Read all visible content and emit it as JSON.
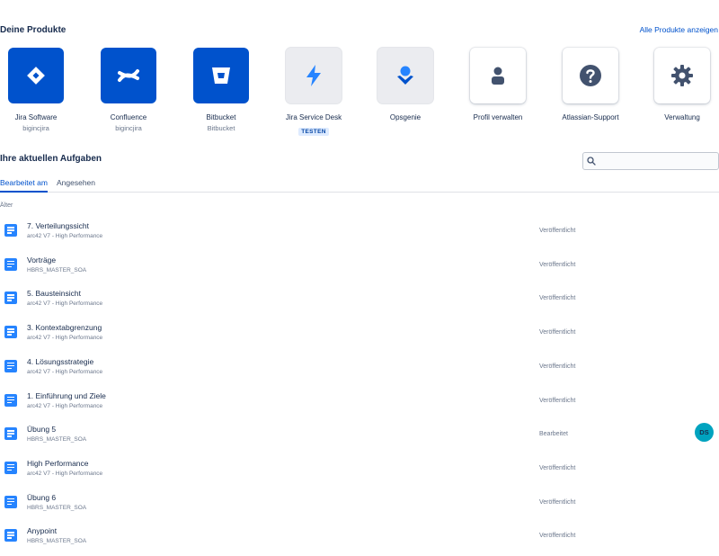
{
  "products_section": {
    "title": "Deine Produkte",
    "all_link": "Alle Produkte anzeigen",
    "items": [
      {
        "name": "Jira Software",
        "sub": "bigincjira",
        "icon": "jira-software-icon"
      },
      {
        "name": "Confluence",
        "sub": "bigincjira",
        "icon": "confluence-icon"
      },
      {
        "name": "Bitbucket",
        "sub": "Bitbucket",
        "icon": "bitbucket-icon"
      },
      {
        "name": "Jira Service Desk",
        "badge": "TESTEN",
        "icon": "jira-service-desk-icon"
      },
      {
        "name": "Opsgenie",
        "icon": "opsgenie-icon"
      },
      {
        "name": "Profil verwalten",
        "icon": "user-profile-icon"
      },
      {
        "name": "Atlassian-Support",
        "icon": "help-icon"
      },
      {
        "name": "Verwaltung",
        "icon": "gear-icon"
      }
    ]
  },
  "tasks_section": {
    "title": "Ihre aktuellen Aufgaben",
    "search": {
      "value": "",
      "placeholder": ""
    },
    "tabs": [
      {
        "label": "Bearbeitet am",
        "active": true
      },
      {
        "label": "Angesehen",
        "active": false
      }
    ],
    "group_label": "Älter",
    "items": [
      {
        "title": "7. Verteilungssicht",
        "space": "arc42 V7 - High Performance",
        "status": "Veröffentlicht"
      },
      {
        "title": "Vorträge",
        "space": "HBRS_MASTER_SOA",
        "status": "Veröffentlicht"
      },
      {
        "title": "5. Bausteinsicht",
        "space": "arc42 V7 - High Performance",
        "status": "Veröffentlicht"
      },
      {
        "title": "3. Kontextabgrenzung",
        "space": "arc42 V7 - High Performance",
        "status": "Veröffentlicht"
      },
      {
        "title": "4. Lösungsstrategie",
        "space": "arc42 V7 - High Performance",
        "status": "Veröffentlicht"
      },
      {
        "title": "1. Einführung und Ziele",
        "space": "arc42 V7 - High Performance",
        "status": "Veröffentlicht"
      },
      {
        "title": "Übung 5",
        "space": "HBRS_MASTER_SOA",
        "status": "Bearbeitet",
        "avatar": "DS"
      },
      {
        "title": "High Performance",
        "space": "arc42 V7 - High Performance",
        "status": "Veröffentlicht"
      },
      {
        "title": "Übung 6",
        "space": "HBRS_MASTER_SOA",
        "status": "Veröffentlicht"
      },
      {
        "title": "Anypoint",
        "space": "HBRS_MASTER_SOA",
        "status": "Veröffentlicht"
      }
    ]
  },
  "colors": {
    "brand_blue": "#0052cc",
    "doc_icon_blue": "#2684ff",
    "avatar_teal": "#00a3bf",
    "text_primary": "#172b4d",
    "text_secondary": "#6b778c"
  }
}
